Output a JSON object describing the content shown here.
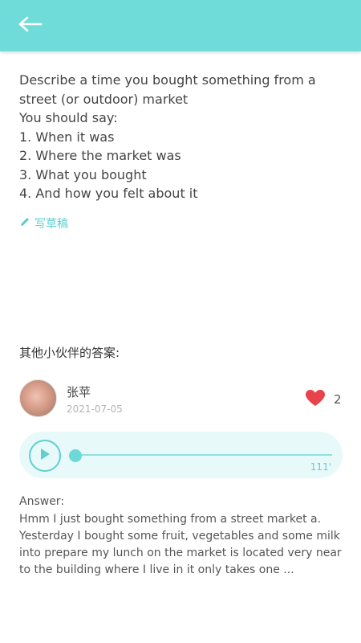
{
  "header": {
    "back_icon": "arrow-left-icon",
    "color": "#6fdcd9"
  },
  "question": {
    "lines": [
      "Describe a time you bought something from a",
      "street (or outdoor) market",
      "You should say:",
      "1. When it was",
      "2. Where the market was",
      "3. What you bought",
      "4. And how you felt about it"
    ]
  },
  "draft": {
    "label": "写草稿",
    "icon": "pencil-icon"
  },
  "others": {
    "title": "其他小伙伴的答案:"
  },
  "answer_card": {
    "user_name": "张苹",
    "date": "2021-07-05",
    "likes": "2",
    "audio": {
      "duration": "111'",
      "progress": 0
    },
    "answer_label": "Answer:",
    "answer_text": "Hmm I just bought something from a street market a. Yesterday I bought some fruit, vegetables and some milk into prepare my lunch on the market is located very near to the building where I live in it only takes one ..."
  },
  "colors": {
    "accent": "#6fdcd9",
    "heart": "#e8434b"
  }
}
